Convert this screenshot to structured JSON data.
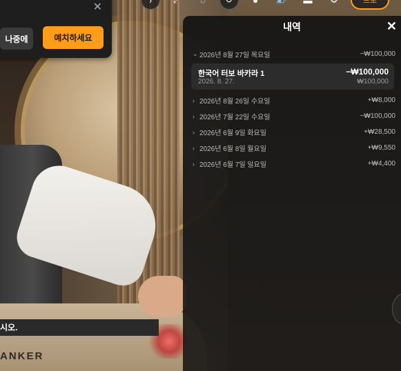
{
  "popup": {
    "close_glyph": "✕",
    "later_label": "나중에",
    "deposit_label": "예치하세요"
  },
  "topbar": {
    "partial_label": "프로"
  },
  "video": {
    "subtitle": "시오.",
    "table_text": "ANKER"
  },
  "history": {
    "title": "내역",
    "close_glyph": "✕",
    "days": [
      {
        "date": "2026년 8월 27일 목요일",
        "amount": "−₩100,000",
        "expanded": true
      },
      {
        "date": "2026년 8월 26일 수요일",
        "amount": "+₩8,000",
        "expanded": false
      },
      {
        "date": "2026년 7월 22일 수요일",
        "amount": "−₩100,000",
        "expanded": false
      },
      {
        "date": "2026년 6월 9일 화요일",
        "amount": "+₩28,500",
        "expanded": false
      },
      {
        "date": "2026년 6월 8일 월요일",
        "amount": "+₩9,550",
        "expanded": false
      },
      {
        "date": "2026년 6월 7일 일요일",
        "amount": "+₩4,400",
        "expanded": false
      }
    ],
    "transaction": {
      "game": "한국어 터보 바카라 1",
      "date": "2026. 8. 27.",
      "amount": "−₩100,000",
      "bet": "₩100,000"
    }
  },
  "colors": {
    "accent": "#ff9d1b",
    "panel_bg": "#161616",
    "row_bg": "#2c2c2c"
  }
}
